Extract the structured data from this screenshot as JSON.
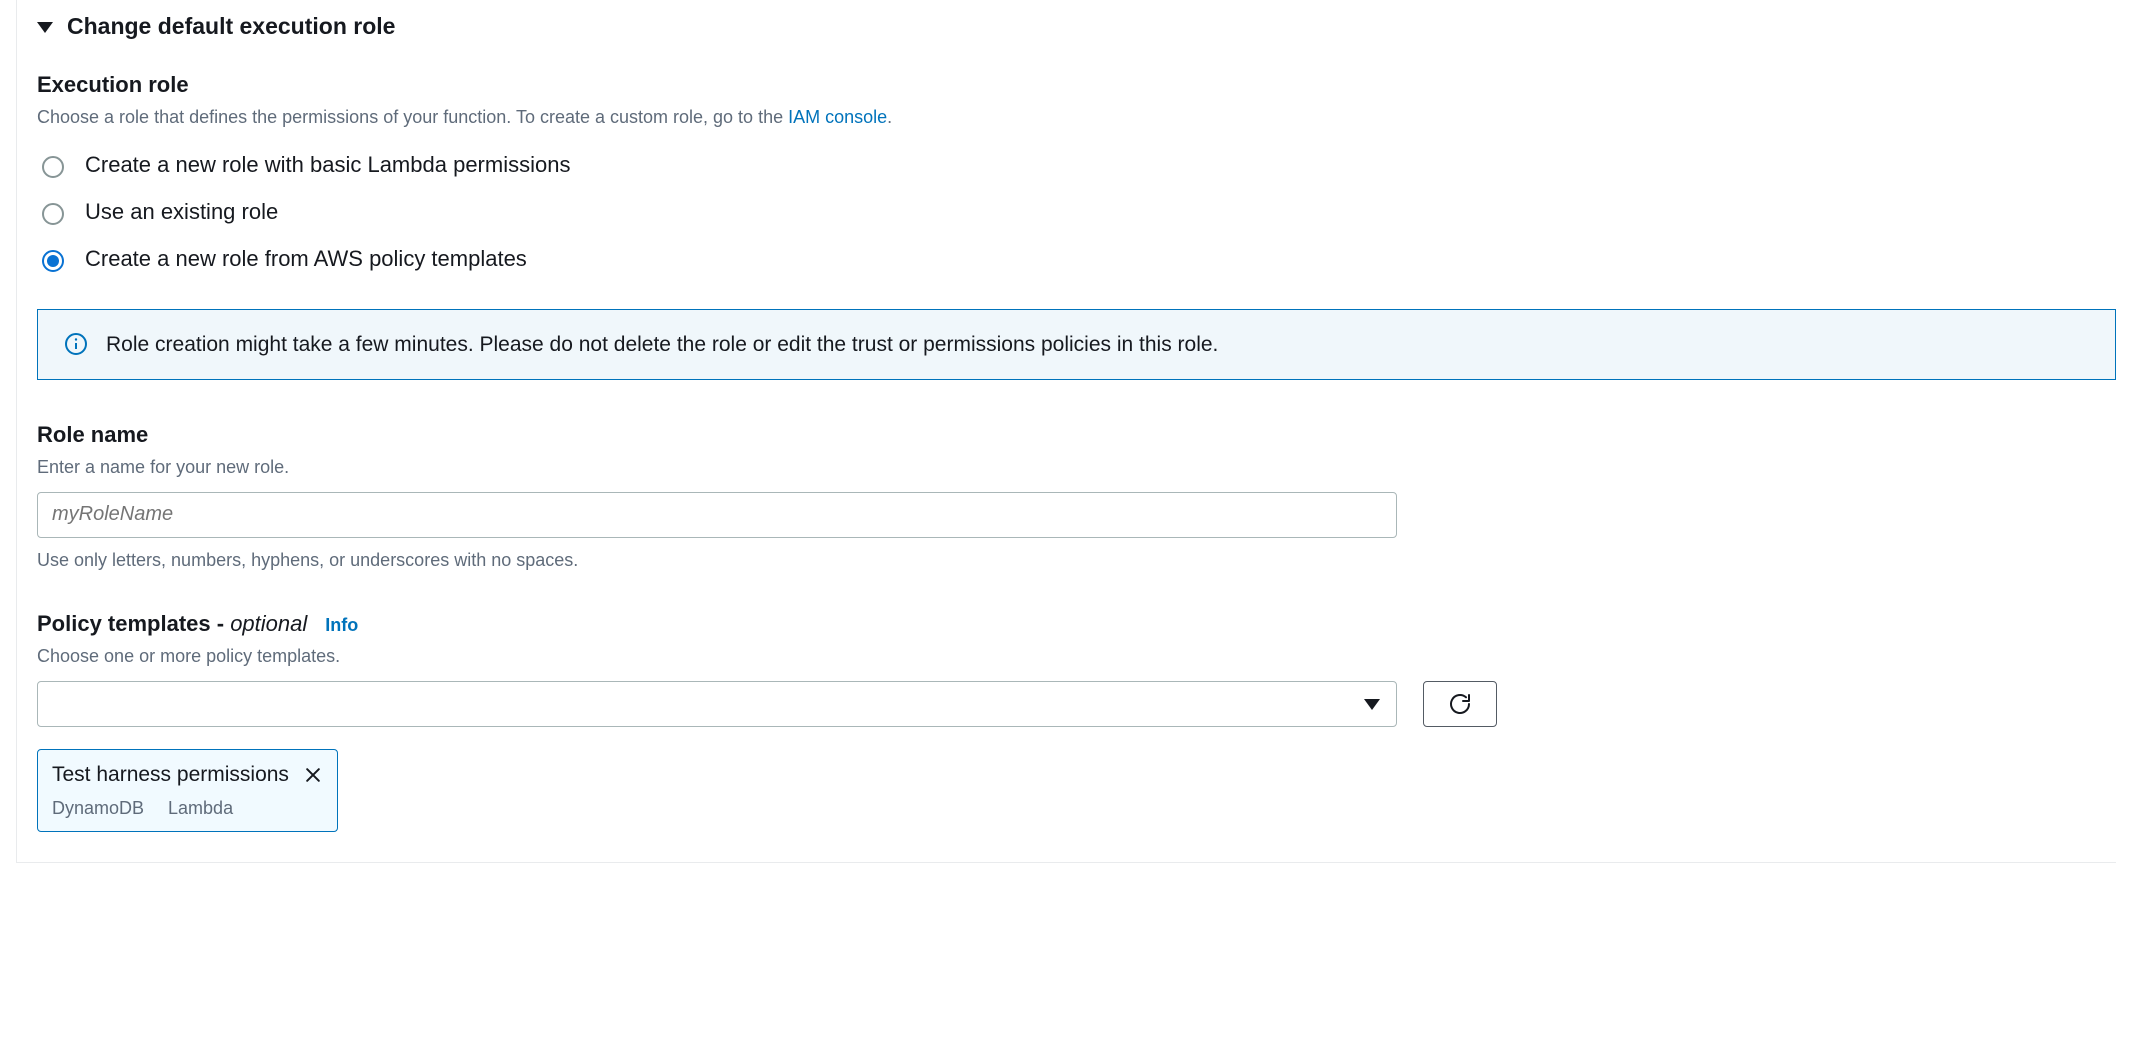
{
  "header": {
    "title": "Change default execution role"
  },
  "executionRole": {
    "label": "Execution role",
    "description_pre": "Choose a role that defines the permissions of your function. To create a custom role, go to the ",
    "description_link": "IAM console",
    "description_post": ".",
    "options": [
      "Create a new role with basic Lambda permissions",
      "Use an existing role",
      "Create a new role from AWS policy templates"
    ],
    "selected_index": 2
  },
  "alert": {
    "text": "Role creation might take a few minutes. Please do not delete the role or edit the trust or permissions policies in this role."
  },
  "roleName": {
    "label": "Role name",
    "description": "Enter a name for your new role.",
    "placeholder": "myRoleName",
    "value": "",
    "hint": "Use only letters, numbers, hyphens, or underscores with no spaces."
  },
  "policyTemplates": {
    "label": "Policy templates - ",
    "optional": "optional",
    "info": "Info",
    "description": "Choose one or more policy templates.",
    "selected_token": {
      "title": "Test harness permissions",
      "subs": [
        "DynamoDB",
        "Lambda"
      ]
    }
  }
}
